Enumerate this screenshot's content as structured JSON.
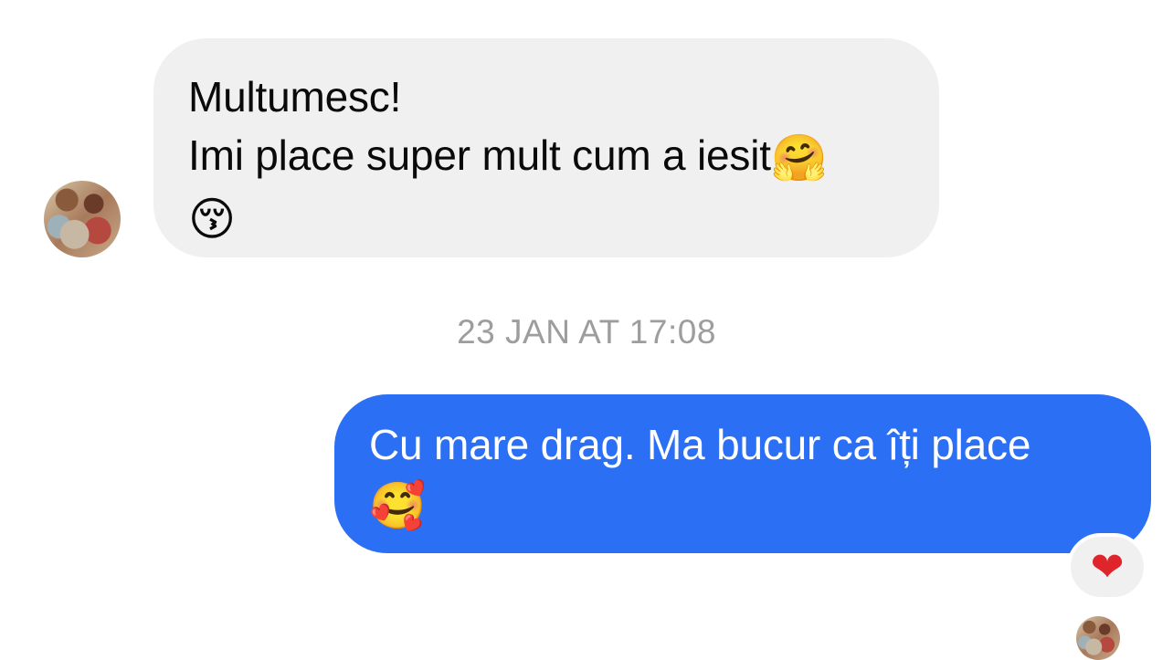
{
  "conversation": {
    "received_message": {
      "line1": "Multumesc!",
      "line2": "Imi place super mult cum a iesit",
      "line2_emoji": "🤗",
      "line3_emoji": "😚"
    },
    "timestamp": "23 JAN AT 17:08",
    "sent_message": {
      "line1": "Cu mare drag. Ma bucur ca îți place",
      "line2_emoji": "🥰"
    },
    "reaction": {
      "emoji": "❤"
    }
  },
  "colors": {
    "received_bubble": "#f0f0f0",
    "sent_bubble": "#2a6ff4",
    "timestamp_text": "#9d9d9d",
    "reaction_heart": "#e0242c"
  }
}
